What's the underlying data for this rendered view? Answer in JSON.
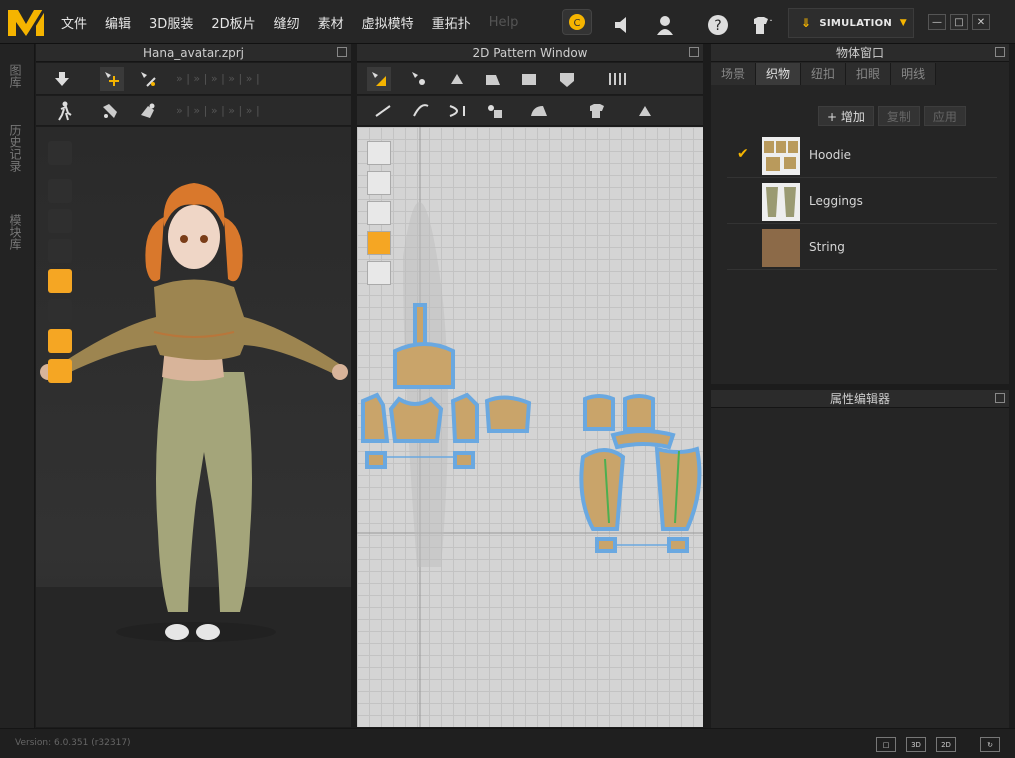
{
  "menu": [
    {
      "label": "文件"
    },
    {
      "label": "编辑"
    },
    {
      "label": "3D服装"
    },
    {
      "label": "2D板片"
    },
    {
      "label": "缝纫"
    },
    {
      "label": "素材"
    },
    {
      "label": "虚拟模特"
    },
    {
      "label": "重拓扑"
    },
    {
      "label": "Help"
    }
  ],
  "simulation": {
    "label": "SIMULATION"
  },
  "left_strip": {
    "tab1": "图库",
    "tab2": "历史记录",
    "tab3": "模块库"
  },
  "viewport3d": {
    "title": "Hana_avatar.zprj"
  },
  "pattern_window": {
    "title": "2D Pattern Window"
  },
  "object_window": {
    "title": "物体窗口",
    "tabs": [
      {
        "label": "场景"
      },
      {
        "label": "织物"
      },
      {
        "label": "纽扣"
      },
      {
        "label": "扣眼"
      },
      {
        "label": "明线"
      }
    ],
    "actions": {
      "add": "增加",
      "copy": "复制",
      "apply": "应用"
    },
    "fabrics": [
      {
        "name": "Hoodie",
        "selected": true,
        "color": "#b99a5c"
      },
      {
        "name": "Leggings",
        "selected": false,
        "color": "#9a9a72"
      },
      {
        "name": "String",
        "selected": false,
        "color": "#8c6a48"
      }
    ]
  },
  "property_editor": {
    "title": "属性编辑器"
  },
  "status": {
    "version": "Version: 6.0.351 (r32317)"
  },
  "view_buttons": {
    "view3d": "3D",
    "view2d": "2D"
  },
  "colors": {
    "accent": "#f5b400",
    "pattern_outline": "#6aa8e0",
    "pattern_fill": "#c9a46a"
  }
}
